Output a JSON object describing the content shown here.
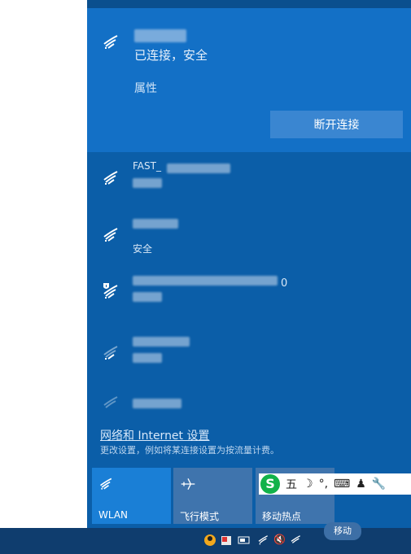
{
  "connected_network": {
    "status": "已连接，安全",
    "properties_link": "属性",
    "disconnect_button": "断开连接"
  },
  "networks": [
    {
      "ssid_fragment": "FAST_",
      "secured": true
    },
    {
      "ssid_fragment": "",
      "secured": true,
      "status_fragment": "安全"
    },
    {
      "ssid_fragment": "0",
      "secured": false
    },
    {
      "ssid_fragment": "",
      "secured": true
    },
    {
      "ssid_fragment": "",
      "secured": true
    }
  ],
  "settings": {
    "link": "网络和 Internet 设置",
    "description": "更改设置，例如将某连接设置为按流量计费。"
  },
  "quick_actions": [
    {
      "label": "WLAN",
      "icon": "wifi-icon",
      "active": true
    },
    {
      "label": "飞行模式",
      "icon": "airplane-icon",
      "active": false
    },
    {
      "label": "移动热点",
      "icon": "hotspot-icon",
      "active": false
    }
  ],
  "ime_toolbar": {
    "logo": "S",
    "mode": "五"
  },
  "tooltip": "移动"
}
